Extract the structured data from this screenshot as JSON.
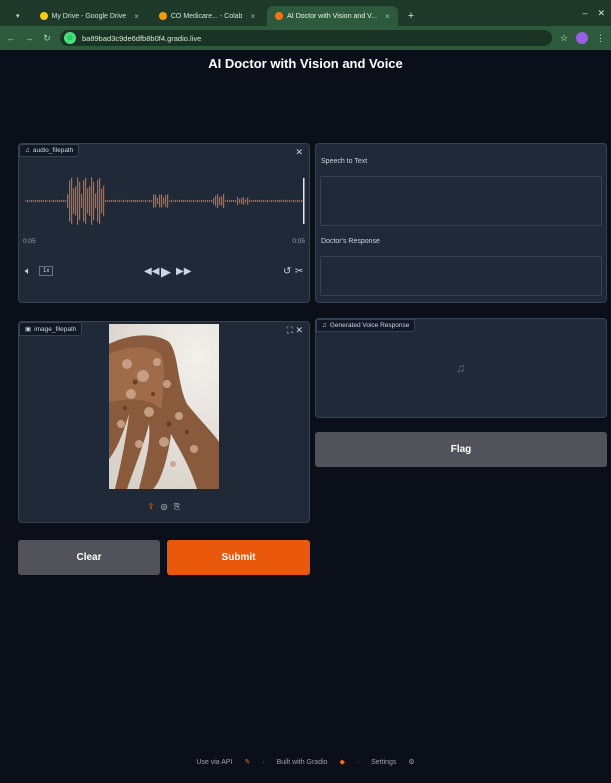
{
  "browser": {
    "tabs": [
      {
        "label": "My Drive - Google Drive",
        "favicon_color": "#facc15"
      },
      {
        "label": "CO Medicare... - Colab",
        "favicon_color": "#f59e0b"
      },
      {
        "label": "AI Doctor with Vision and V...",
        "favicon_color": "#f97316"
      }
    ],
    "url": "ba89bad3c9de6dfb8b0f4.gradio.live"
  },
  "app": {
    "title": "AI Doctor with Vision and Voice",
    "audio": {
      "label": "audio_filepath",
      "current_time": "0:05",
      "duration": "0:05",
      "rate": "1x"
    },
    "image": {
      "label": "image_filepath"
    },
    "buttons": {
      "clear": "Clear",
      "submit": "Submit",
      "flag": "Flag"
    },
    "outputs": {
      "speech_to_text": "Speech to Text",
      "doctor_response": "Doctor's Response",
      "voice_response": "Generated Voice Response"
    },
    "footer": {
      "use_api": "Use via API",
      "built_with": "Built with Gradio",
      "settings": "Settings"
    }
  },
  "colors": {
    "accent": "#ea580c",
    "background": "#0b0f19",
    "panel": "#1f2937"
  }
}
